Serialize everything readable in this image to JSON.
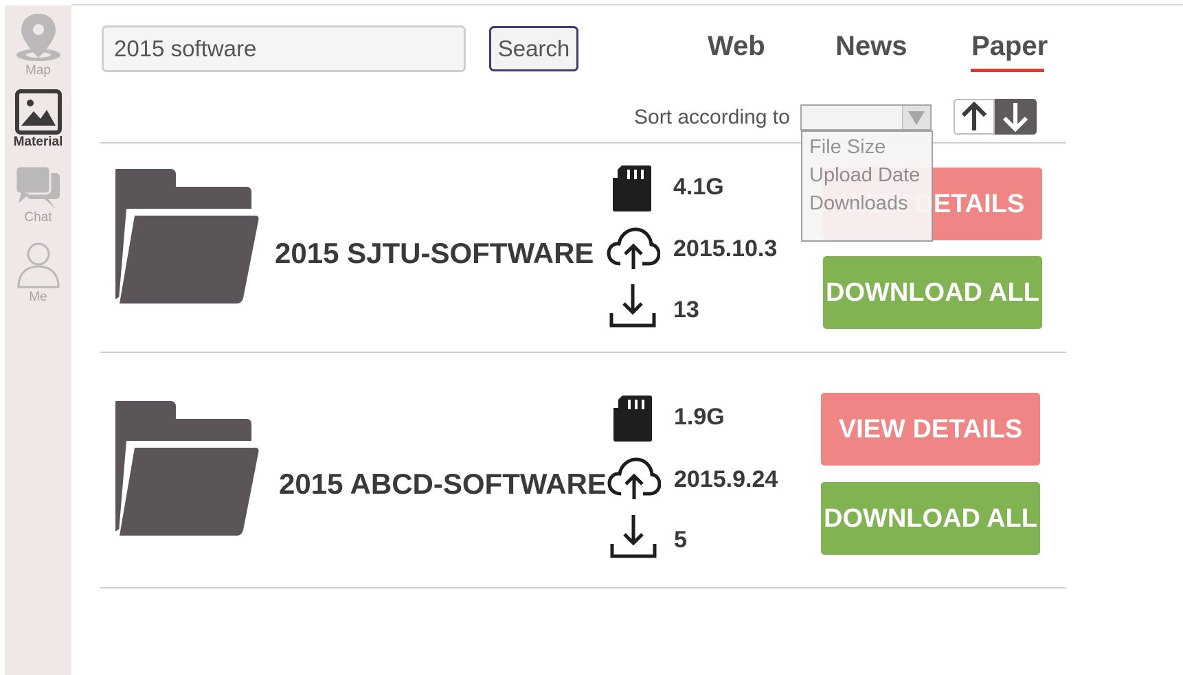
{
  "sidebar": {
    "items": [
      {
        "label": "Map",
        "icon": "map-pin-icon",
        "active": false
      },
      {
        "label": "Material",
        "icon": "image-icon",
        "active": true
      },
      {
        "label": "Chat",
        "icon": "chat-bubbles-icon",
        "active": false
      },
      {
        "label": "Me",
        "icon": "person-icon",
        "active": false
      }
    ]
  },
  "search": {
    "value": "2015 software",
    "button_label": "Search"
  },
  "tabs": [
    {
      "label": "Web",
      "active": false
    },
    {
      "label": "News",
      "active": false
    },
    {
      "label": "Paper",
      "active": true
    }
  ],
  "sort": {
    "label": "Sort according to",
    "selected": "",
    "options": [
      "File Size",
      "Upload Date",
      "Downloads"
    ]
  },
  "results": [
    {
      "name": "2015 SJTU-SOFTWARE",
      "size": "4.1G",
      "date": "2015.10.3",
      "downloads": "13",
      "view_label": "VIEW DETAILS",
      "download_label": "DOWNLOAD ALL"
    },
    {
      "name": "2015 ABCD-SOFTWARE",
      "size": "1.9G",
      "date": "2015.9.24",
      "downloads": "5",
      "view_label": "VIEW DETAILS",
      "download_label": "DOWNLOAD ALL"
    }
  ],
  "colors": {
    "accent_underline": "#e0393a",
    "view_button": "#ef8584",
    "download_button": "#82b352",
    "sidebar_bg": "#efe8e6",
    "icon_dark": "#5b5458"
  }
}
